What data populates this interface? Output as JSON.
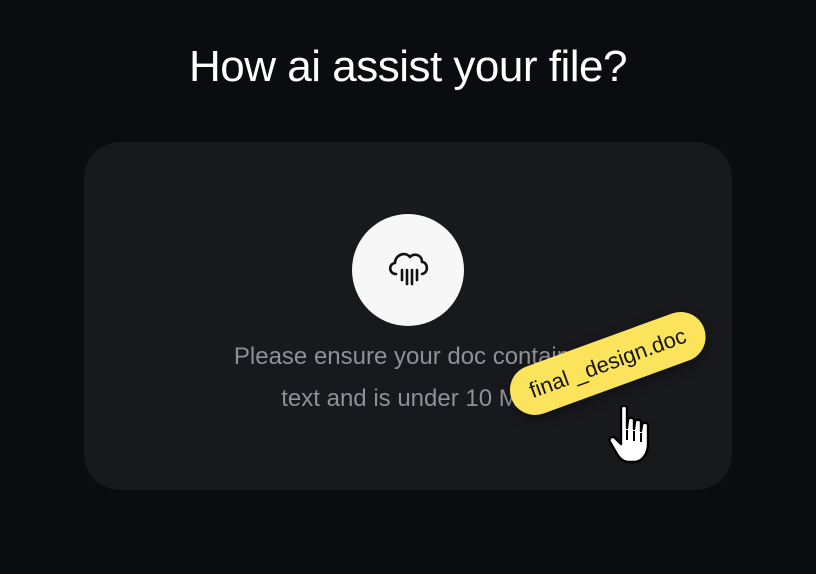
{
  "heading": "How ai assist your file?",
  "dropzone": {
    "icon": "cloud-rain-upload-icon",
    "hint_line1": "Please ensure your doc contains",
    "hint_line2": "text and is under 10 MB"
  },
  "dragged_file": {
    "name": "final _design.doc"
  },
  "cursor_icon": "hand-pointer-icon",
  "colors": {
    "background": "#0a0c0f",
    "card": "#17191d",
    "accent": "#fbe35c",
    "hint_text": "#8e9096"
  }
}
